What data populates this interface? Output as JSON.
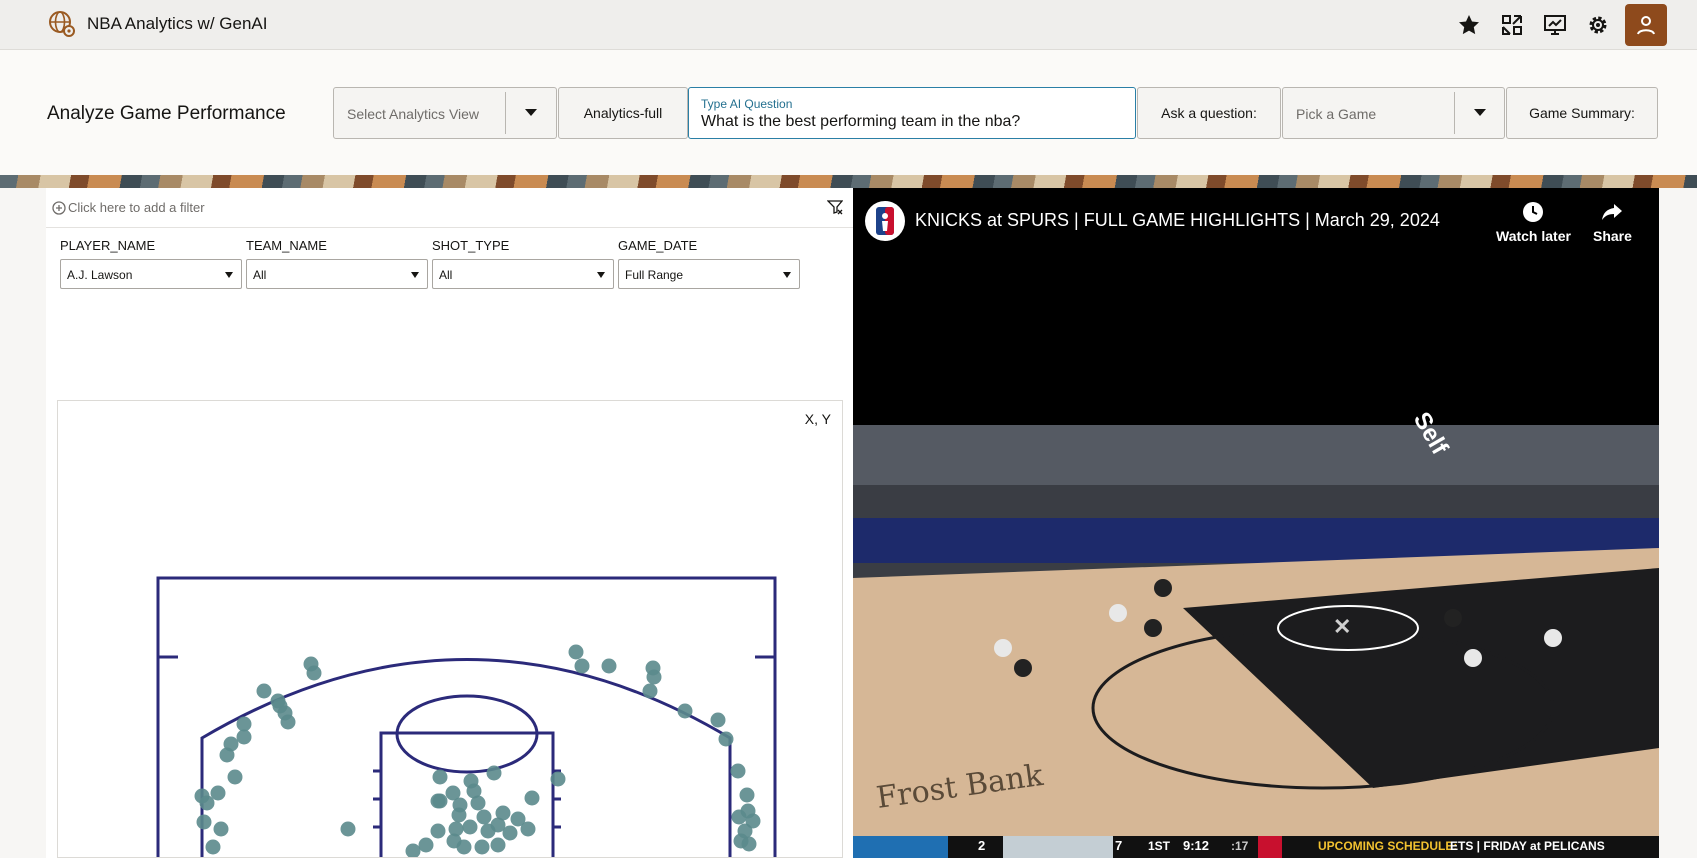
{
  "app": {
    "title": "NBA Analytics w/ GenAI"
  },
  "topbar": {
    "icons": [
      "star-icon",
      "share-arrows-icon",
      "presentation-icon",
      "gear-icon",
      "user-icon"
    ]
  },
  "header": {
    "page_title": "Analyze Game Performance",
    "analytics_view": {
      "placeholder": "Select Analytics View"
    },
    "analytics_full_label": "Analytics-full",
    "ai_question": {
      "label": "Type AI Question",
      "value": "What is the best performing team in the nba?"
    },
    "ask_label": "Ask a question:",
    "game_picker": {
      "placeholder": "Pick a Game"
    },
    "game_summary_label": "Game Summary:"
  },
  "filters": {
    "add_filter_label": "Click here to add a filter",
    "items": [
      {
        "label": "PLAYER_NAME",
        "value": "A.J. Lawson"
      },
      {
        "label": "TEAM_NAME",
        "value": "All"
      },
      {
        "label": "SHOT_TYPE",
        "value": "All"
      },
      {
        "label": "GAME_DATE",
        "value": "Full Range"
      }
    ]
  },
  "chart": {
    "corner_label": "X, Y",
    "court_color": "#2b2a7a",
    "point_color": "#5b8a8c"
  },
  "video": {
    "title": "KNICKS at SPURS | FULL GAME HIGHLIGHTS | March 29, 2024",
    "watch_later": "Watch later",
    "share": "Share",
    "scorebar": {
      "away_score": "2",
      "home_score": "7",
      "period": "1ST",
      "clock": "9:12",
      "shot_clock": ":17",
      "ticker": "UPCOMING SCHEDULE:",
      "ticker_text": "ETS | FRIDAY at PELICANS"
    },
    "court_sign": "Frost Bank"
  }
}
